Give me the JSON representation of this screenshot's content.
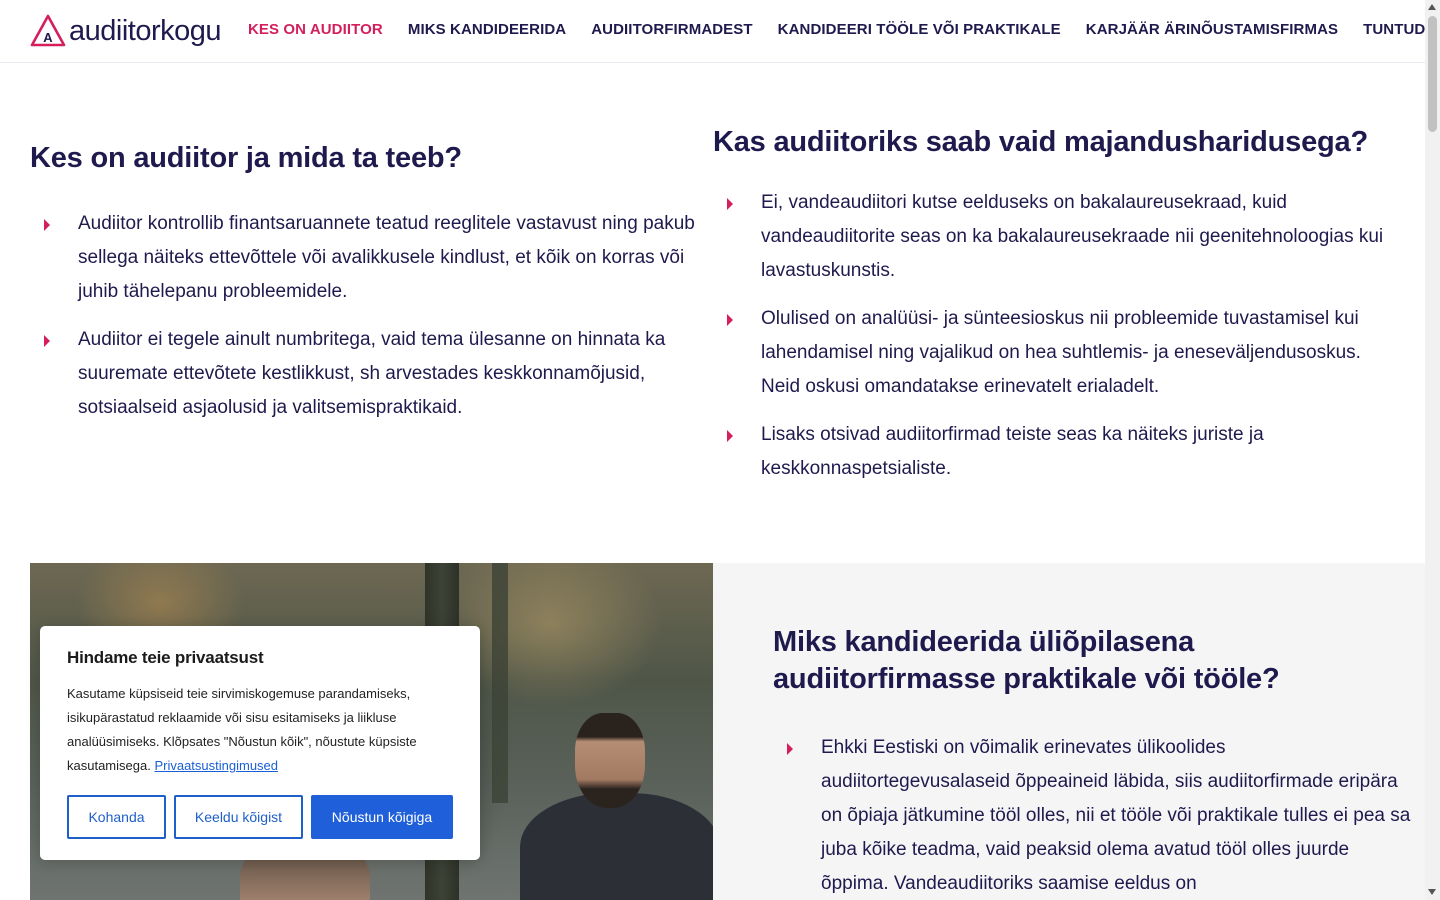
{
  "brand": {
    "name": "audiitorkogu",
    "accent": "#d41f5c",
    "text_color": "#1f1a4d"
  },
  "nav": {
    "items": [
      {
        "label": "KES ON AUDIITOR",
        "active": true
      },
      {
        "label": "MIKS KANDIDEERIDA",
        "active": false
      },
      {
        "label": "AUDIITORFIRMADEST",
        "active": false
      },
      {
        "label": "KANDIDEERI TÖÖLE VÕI PRAKTIKALE",
        "active": false
      },
      {
        "label": "KARJÄÄR ÄRINÕUSTAMISFIRMAS",
        "active": false
      },
      {
        "label": "TUNTUD NÄOD",
        "active": false
      }
    ]
  },
  "section_left": {
    "title": "Kes on audiitor ja mida ta teeb?",
    "bullets": [
      "Audiitor kontrollib finantsaruannete teatud reeglitele vastavust ning pakub sellega näiteks ettevõttele või avalikkusele kindlust, et kõik on korras või juhib tähelepanu probleemidele.",
      "Audiitor ei tegele ainult numbritega, vaid tema ülesanne on hinnata ka suuremate ettevõtete kestlikkust, sh arvestades keskkonnamõjusid, sotsiaalseid asjaolusid ja valitsemispraktikaid."
    ]
  },
  "section_right": {
    "title": "Kas audiitoriks saab vaid majandusharidusega?",
    "bullets": [
      "Ei, vandeaudiitori kutse eelduseks on bakalaureusekraad, kuid vandeaudiitorite seas on ka bakalaureusekraade nii geenitehnoloogias kui lavastuskunstis.",
      "Olulised on analüüsi- ja sünteesioskus nii probleemide tuvastamisel kui lahendamisel ning vajalikud on hea suhtlemis- ja eneseväljendusoskus. Neid oskusi omandatakse erinevatelt erialadelt.",
      "Lisaks otsivad audiitorfirmad teiste seas ka näiteks juriste ja keskkonnaspetsialiste."
    ]
  },
  "section_lower": {
    "title": "Miks kandideerida üliõpilasena audiitorfirmasse praktikale või tööle?",
    "bullets": [
      "Ehkki Eestiski on võimalik erinevates ülikoolides audiitortegevusalaseid õppeaineid läbida, siis audiitorfirmade eripära on õpiaja jätkumine tööl olles, nii et tööle või praktikale tulles ei pea sa juba kõike teadma, vaid peaksid olema avatud tööl olles juurde õppima. Vandeaudiitoriks saamise eeldus on"
    ]
  },
  "cookie": {
    "title": "Hindame teie privaatsust",
    "text": "Kasutame küpsiseid teie sirvimiskogemuse parandamiseks, isikupärastatud reklaamide või sisu esitamiseks ja liikluse analüüsimiseks. Klõpsates \"Nõustun kõik\", nõustute küpsiste kasutamisega.",
    "link": "Privaatsustingimused",
    "buttons": {
      "customize": "Kohanda",
      "reject": "Keeldu kõigist",
      "accept": "Nõustun kõigiga"
    }
  }
}
